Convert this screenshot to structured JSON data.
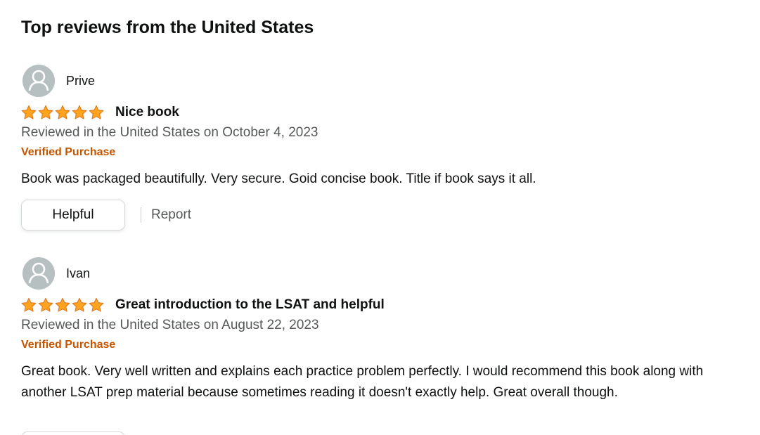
{
  "section": {
    "title": "Top reviews from the United States"
  },
  "reviews": [
    {
      "author": "Prive",
      "rating": 5,
      "rating_max": 5,
      "title": "Nice book",
      "date": "Reviewed in the United States on October 4, 2023",
      "badge": "Verified Purchase",
      "body": "Book was packaged beautifully. Very secure. Goid concise book. Title if book says it all.",
      "helpful_label": "Helpful",
      "report_label": "Report"
    },
    {
      "author": "Ivan",
      "rating": 5,
      "rating_max": 5,
      "title": "Great introduction to the LSAT and helpful",
      "date": "Reviewed in the United States on August 22, 2023",
      "badge": "Verified Purchase",
      "body": "Great book. Very well written and explains each practice problem perfectly. I would recommend this book along with another LSAT prep material because sometimes reading it doesn't exactly help. Great overall though."
    }
  ],
  "icons": {
    "avatar": "default-profile-avatar-icon",
    "star": "star-filled-icon"
  },
  "colors": {
    "star_fill": "#ffa41c",
    "star_stroke": "#de7921",
    "verified": "#c45500",
    "meta_text": "#565959",
    "avatar_bg": "#b6c0c0"
  }
}
